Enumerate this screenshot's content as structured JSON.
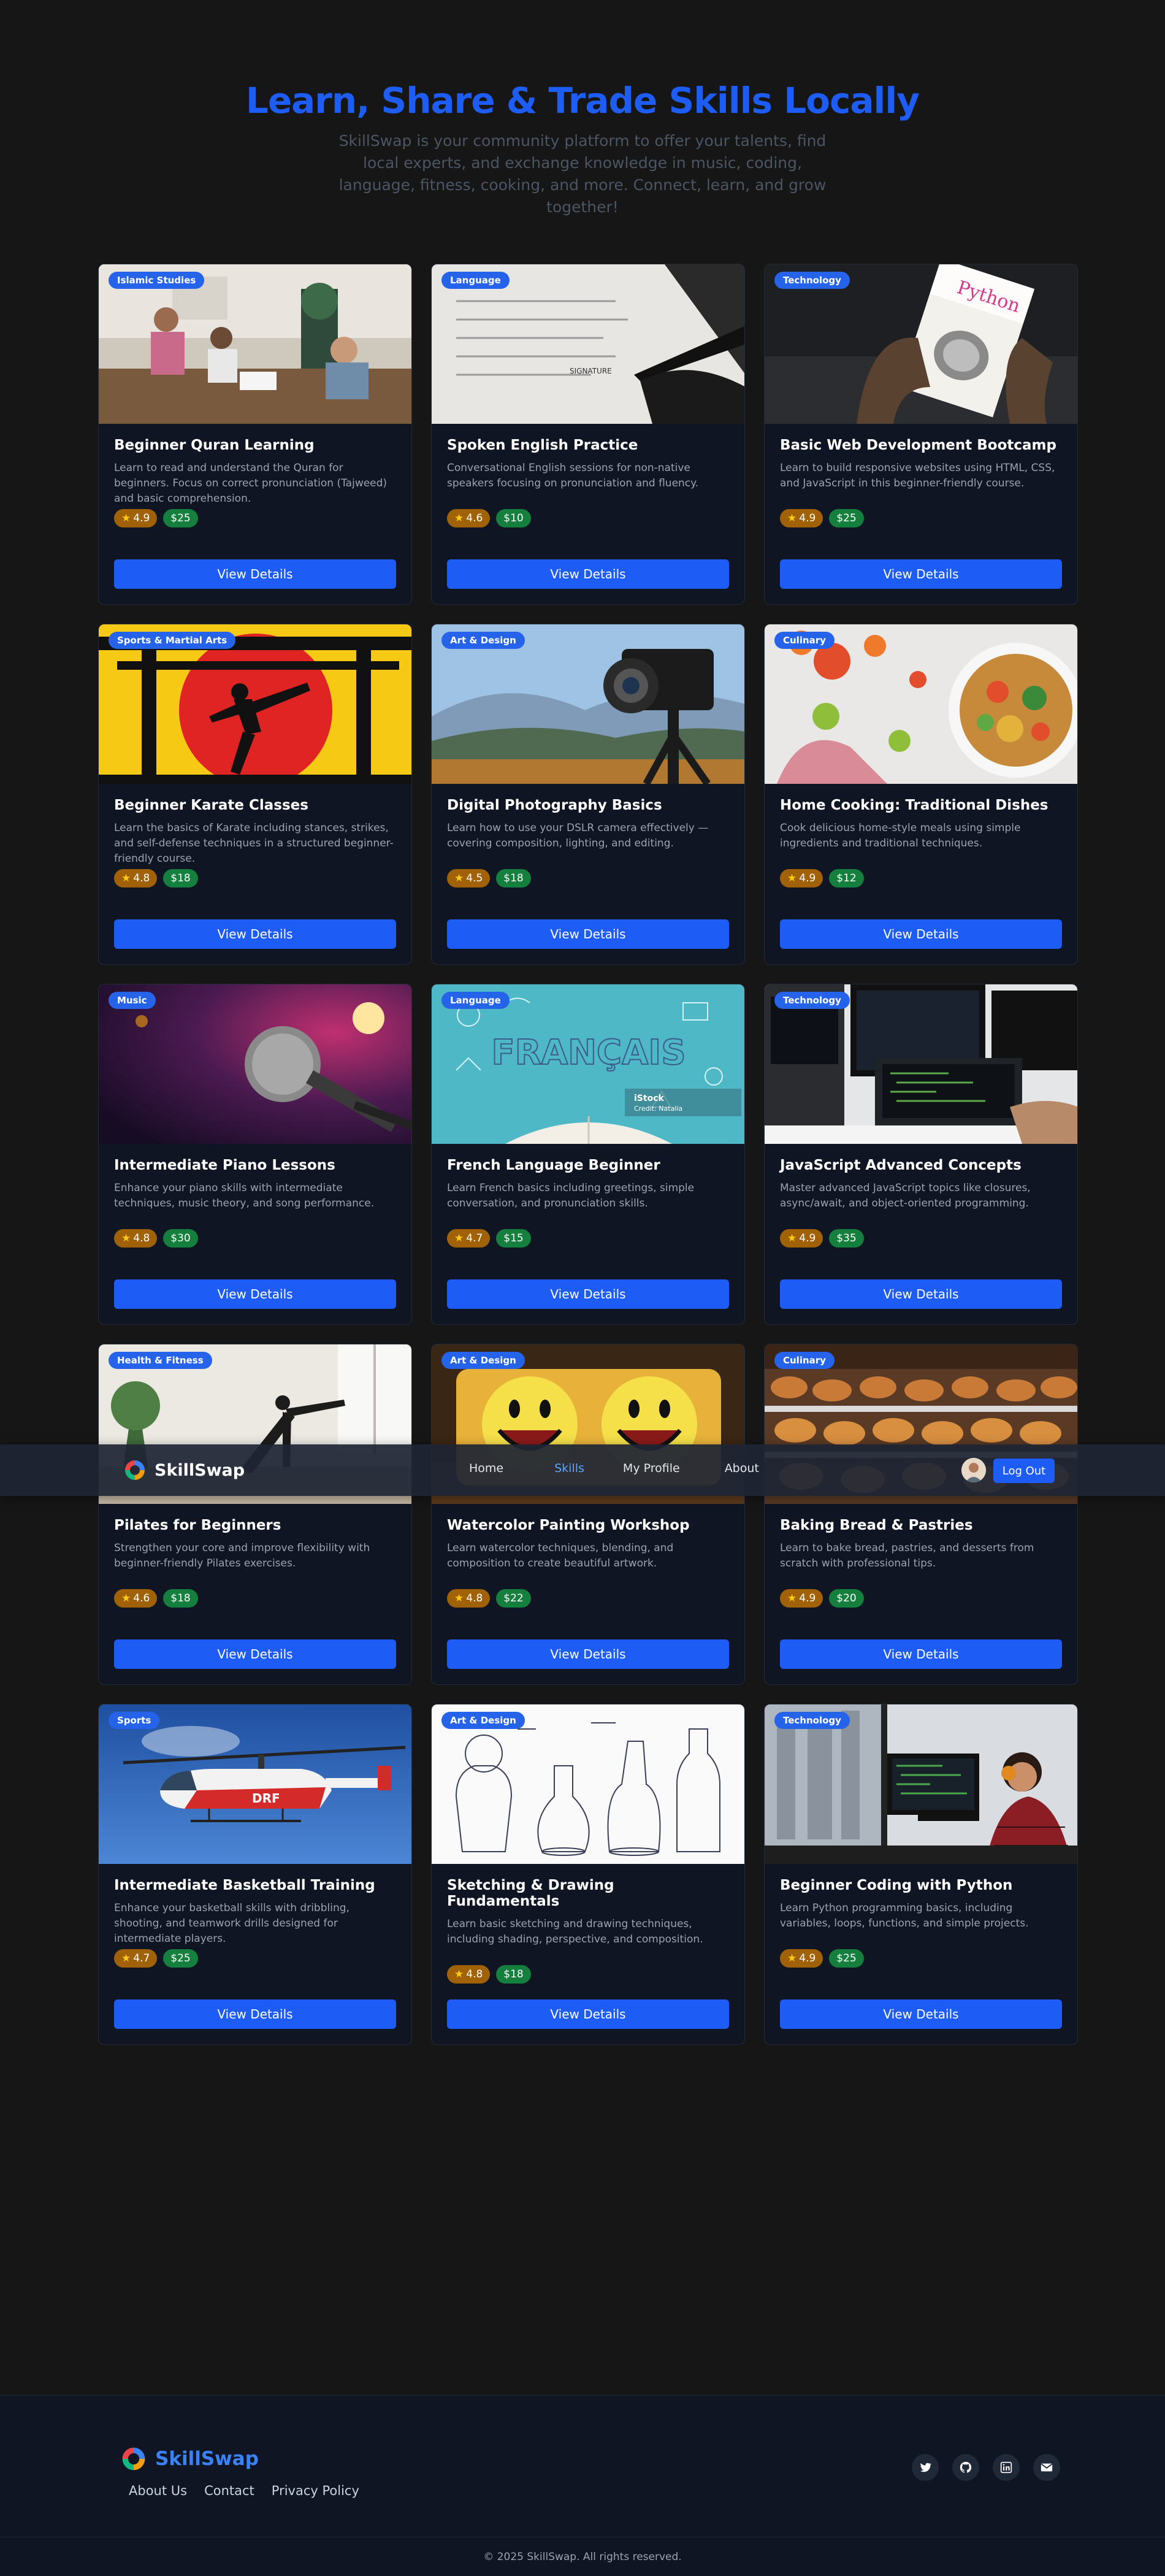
{
  "hero": {
    "title": "Learn, Share & Trade Skills Locally",
    "subtitle": "SkillSwap is your community platform to offer your talents, find local experts, and exchange knowledge in music, coding, language, fitness, cooking, and more. Connect, learn, and grow together!"
  },
  "navbar": {
    "brand": "SkillSwap",
    "links": [
      "Home",
      "Skills",
      "My Profile",
      "About"
    ],
    "active_link": "Skills",
    "logout_label": "Log Out"
  },
  "cards": [
    {
      "category": "Islamic Studies",
      "title": "Beginner Quran Learning",
      "description": "Learn to read and understand the Quran for beginners. Focus on correct pronunciation (Tajweed) and basic comprehension.",
      "rating": "4.9",
      "price": "$25",
      "button": "View Details"
    },
    {
      "category": "Language",
      "title": "Spoken English Practice",
      "description": "Conversational English sessions for non-native speakers focusing on pronunciation and fluency.",
      "rating": "4.6",
      "price": "$10",
      "button": "View Details"
    },
    {
      "category": "Technology",
      "title": "Basic Web Development Bootcamp",
      "description": "Learn to build responsive websites using HTML, CSS, and JavaScript in this beginner-friendly course.",
      "rating": "4.9",
      "price": "$25",
      "button": "View Details"
    },
    {
      "category": "Sports & Martial Arts",
      "title": "Beginner Karate Classes",
      "description": "Learn the basics of Karate including stances, strikes, and self-defense techniques in a structured beginner-friendly course.",
      "rating": "4.8",
      "price": "$18",
      "button": "View Details"
    },
    {
      "category": "Art & Design",
      "title": "Digital Photography Basics",
      "description": "Learn how to use your DSLR camera effectively — covering composition, lighting, and editing.",
      "rating": "4.5",
      "price": "$18",
      "button": "View Details"
    },
    {
      "category": "Culinary",
      "title": "Home Cooking: Traditional Dishes",
      "description": "Cook delicious home-style meals using simple ingredients and traditional techniques.",
      "rating": "4.9",
      "price": "$12",
      "button": "View Details"
    },
    {
      "category": "Music",
      "title": "Intermediate Piano Lessons",
      "description": "Enhance your piano skills with intermediate techniques, music theory, and song performance.",
      "rating": "4.8",
      "price": "$30",
      "button": "View Details"
    },
    {
      "category": "Language",
      "title": "French Language Beginner",
      "description": "Learn French basics including greetings, simple conversation, and pronunciation skills.",
      "rating": "4.7",
      "price": "$15",
      "button": "View Details"
    },
    {
      "category": "Technology",
      "title": "JavaScript Advanced Concepts",
      "description": "Master advanced JavaScript topics like closures, async/await, and object-oriented programming.",
      "rating": "4.9",
      "price": "$35",
      "button": "View Details"
    },
    {
      "category": "Health & Fitness",
      "title": "Pilates for Beginners",
      "description": "Strengthen your core and improve flexibility with beginner-friendly Pilates exercises.",
      "rating": "4.6",
      "price": "$18",
      "button": "View Details"
    },
    {
      "category": "Art & Design",
      "title": "Watercolor Painting Workshop",
      "description": "Learn watercolor techniques, blending, and composition to create beautiful artwork.",
      "rating": "4.8",
      "price": "$22",
      "button": "View Details"
    },
    {
      "category": "Culinary",
      "title": "Baking Bread & Pastries",
      "description": "Learn to bake bread, pastries, and desserts from scratch with professional tips.",
      "rating": "4.9",
      "price": "$20",
      "button": "View Details"
    },
    {
      "category": "Sports",
      "title": "Intermediate Basketball Training",
      "description": "Enhance your basketball skills with dribbling, shooting, and teamwork drills designed for intermediate players.",
      "rating": "4.7",
      "price": "$25",
      "button": "View Details"
    },
    {
      "category": "Art & Design",
      "title": "Sketching & Drawing Fundamentals",
      "description": "Learn basic sketching and drawing techniques, including shading, perspective, and composition.",
      "rating": "4.8",
      "price": "$18",
      "button": "View Details"
    },
    {
      "category": "Technology",
      "title": "Beginner Coding with Python",
      "description": "Learn Python programming basics, including variables, loops, functions, and simple projects.",
      "rating": "4.9",
      "price": "$25",
      "button": "View Details"
    }
  ],
  "card_images": {
    "0": {
      "book_word": ""
    },
    "2": {
      "book_word": "Python"
    },
    "7": {
      "book_word": "FRANÇAIS",
      "watermark": "iStock",
      "watermark_sub": "Credit: Natalia"
    },
    "11": {},
    "12": {
      "heli_word": "DRF"
    }
  },
  "footer": {
    "brand": "SkillSwap",
    "links": [
      "About Us",
      "Contact",
      "Privacy Policy"
    ],
    "social_icons": [
      "twitter-icon",
      "github-icon",
      "linkedin-icon",
      "email-icon"
    ],
    "copyright": "© 2025 SkillSwap. All rights reserved."
  },
  "colors": {
    "accent": "#1d5cf5",
    "background": "#161616",
    "card": "#0f1523",
    "rating": "#a16207",
    "price": "#15803d"
  }
}
